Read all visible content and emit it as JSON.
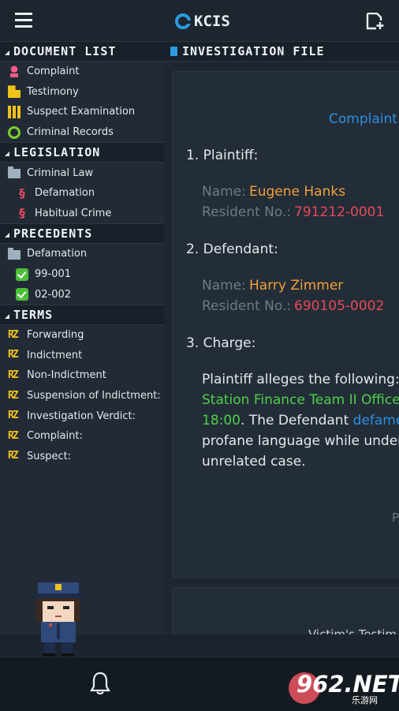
{
  "header": {
    "app_name": "KCIS",
    "menu_icon": "hamburger-menu-icon",
    "new_doc_icon": "new-document-icon",
    "accent": "#2a9ce0"
  },
  "sidebar": {
    "document_list": {
      "title": "DOCUMENT LIST",
      "items": [
        {
          "label": "Complaint",
          "icon": "complaint-person-icon"
        },
        {
          "label": "Testimony",
          "icon": "testimony-icon"
        },
        {
          "label": "Suspect Examination",
          "icon": "examination-icon"
        },
        {
          "label": "Criminal Records",
          "icon": "records-icon"
        }
      ]
    },
    "legislation": {
      "title": "LEGISLATION",
      "folder": "Criminal Law",
      "items": [
        {
          "label": "Defamation",
          "icon": "section-law-icon"
        },
        {
          "label": "Habitual Crime",
          "icon": "section-law-icon"
        }
      ]
    },
    "precedents": {
      "title": "PRECEDENTS",
      "folder": "Defamation",
      "items": [
        {
          "label": "99-001",
          "icon": "check-icon"
        },
        {
          "label": "02-002",
          "icon": "check-icon"
        }
      ]
    },
    "terms": {
      "title": "TERMS",
      "items": [
        {
          "label": "Forwarding"
        },
        {
          "label": "Indictment"
        },
        {
          "label": "Non-Indictment"
        },
        {
          "label": "Suspension of Indictment:"
        },
        {
          "label": "Investigation Verdict:"
        },
        {
          "label": "Complaint:"
        },
        {
          "label": "Suspect:"
        }
      ]
    }
  },
  "investigation": {
    "title": "INVESTIGATION FILE",
    "doc_title": "Complaint",
    "plaintiff": {
      "heading": "1. Plaintiff:",
      "name_label": "Name:",
      "name": "Eugene Hanks",
      "resident_label": "Resident No.:",
      "resident_no": "791212-0001"
    },
    "defendant": {
      "heading": "2. Defendant:",
      "name_label": "Name:",
      "name": "Harry Zimmer",
      "resident_label": "Resident No.:",
      "resident_no": "690105-0002"
    },
    "charge": {
      "heading": "3. Charge:",
      "line1": "Plaintiff alleges the following:",
      "line2_green": "Station Finance Team II Office",
      "line3_green": "18:00",
      "line3_white": ". The Defendant ",
      "line3_blue": "defame",
      "line4": "profane language while under",
      "line5": "unrelated case."
    },
    "partial_letter": "P",
    "second_card_title": "Victim's Testim"
  },
  "bottom": {
    "bell_icon": "bell-icon",
    "watermark": "962.NET",
    "watermark_sub": "乐游网"
  }
}
